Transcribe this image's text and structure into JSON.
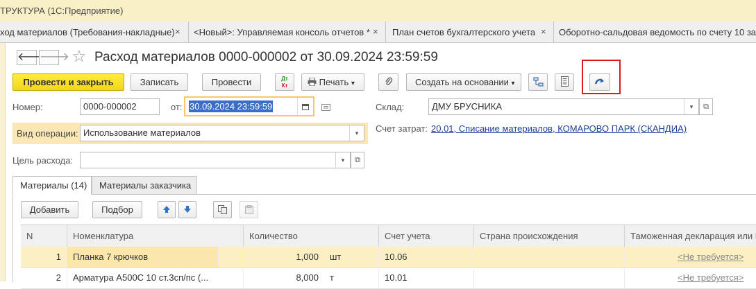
{
  "window": {
    "title": "ТРУКТУРА  (1С:Предприятие)"
  },
  "tabs": [
    {
      "label": "ход материалов (Требования-накладные)",
      "close": "×"
    },
    {
      "label": "<Новый>: Управляемая консоль отчетов *",
      "close": "×"
    },
    {
      "label": "План счетов бухгалтерского учета",
      "close": "×"
    },
    {
      "label": "Оборотно-сальдовая ведомость по счету 10 за",
      "close": ""
    }
  ],
  "nav": {
    "back": "🡐",
    "forward": "🡒",
    "star": "☆"
  },
  "document": {
    "title": "Расход материалов 0000-000002 от 30.09.2024 23:59:59"
  },
  "toolbar": {
    "post_close": "Провести и закрыть",
    "save": "Записать",
    "post": "Провести",
    "dtkt_top": "Дт",
    "dtkt_bottom": "Кт",
    "print": "Печать",
    "print_arrow": "▾",
    "create_based": "Создать на основании",
    "create_arrow": "▾"
  },
  "fields": {
    "number_label": "Номер:",
    "number_value": "0000-000002",
    "date_label": "от:",
    "date_value": "30.09.2024 23:59:59",
    "warehouse_label": "Склад:",
    "warehouse_value": "ДМУ БРУСНИКА",
    "op_label": "Вид операции:",
    "op_value": "Использование материалов",
    "cost_label": "Счет затрат:",
    "cost_value": "20.01, Списание материалов, КОМАРОВО ПАРК (СКАНДИА)",
    "purpose_label": "Цель расхода:",
    "purpose_value": "",
    "dd_arrow": "▾",
    "open_icon": "⧉"
  },
  "body_tabs": [
    {
      "label": "Материалы (14)"
    },
    {
      "label": "Материалы заказчика"
    }
  ],
  "table_toolbar": {
    "add": "Добавить",
    "select": "Подбор"
  },
  "table": {
    "columns": [
      "N",
      "Номенклатура",
      "Количество",
      "Счет учета",
      "Страна происхождения",
      "Таможенная декларация или Р"
    ],
    "rows": [
      {
        "n": "1",
        "name": "Планка 7 крючков",
        "qty": "1,000",
        "unit": "шт",
        "account": "10.06",
        "country": "",
        "customs": "<Не требуется>"
      },
      {
        "n": "2",
        "name": "Арматура А500С 10 ст.3сп/пс (...",
        "qty": "8,000",
        "unit": "т",
        "account": "10.01",
        "country": "",
        "customs": "<Не требуется>"
      }
    ]
  },
  "colors": {
    "accent_yellow": "#f6d71e",
    "highlight_row": "#fbefc3",
    "link_blue": "#1c3e9c",
    "alert_red": "#e01717"
  }
}
